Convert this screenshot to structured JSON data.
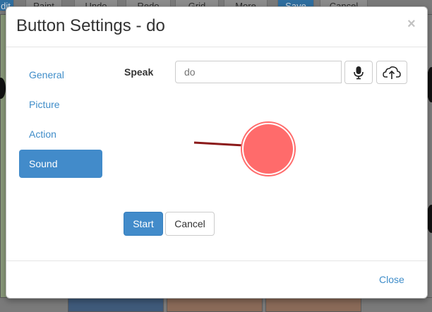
{
  "background_toolbar": {
    "buttons": [
      "dit",
      "Paint",
      "Undo",
      "Redo",
      "Grid",
      "More",
      "Save",
      "Cancel"
    ]
  },
  "modal": {
    "title": "Button Settings - do",
    "close_symbol": "×",
    "nav": {
      "items": [
        {
          "label": "General",
          "active": false
        },
        {
          "label": "Picture",
          "active": false
        },
        {
          "label": "Action",
          "active": false
        },
        {
          "label": "Sound",
          "active": true
        }
      ]
    },
    "sound": {
      "speak_label": "Speak",
      "speak_value": "do",
      "mic_icon": "microphone-icon",
      "upload_icon": "upload-icon",
      "record_indicator_color": "#ff6b6b",
      "annotation_arrow_color": "#8b1a1a"
    },
    "actions": {
      "start_label": "Start",
      "cancel_label": "Cancel"
    },
    "footer": {
      "close_label": "Close"
    }
  },
  "colors": {
    "primary": "#428bca",
    "link": "#3f8dc9"
  }
}
